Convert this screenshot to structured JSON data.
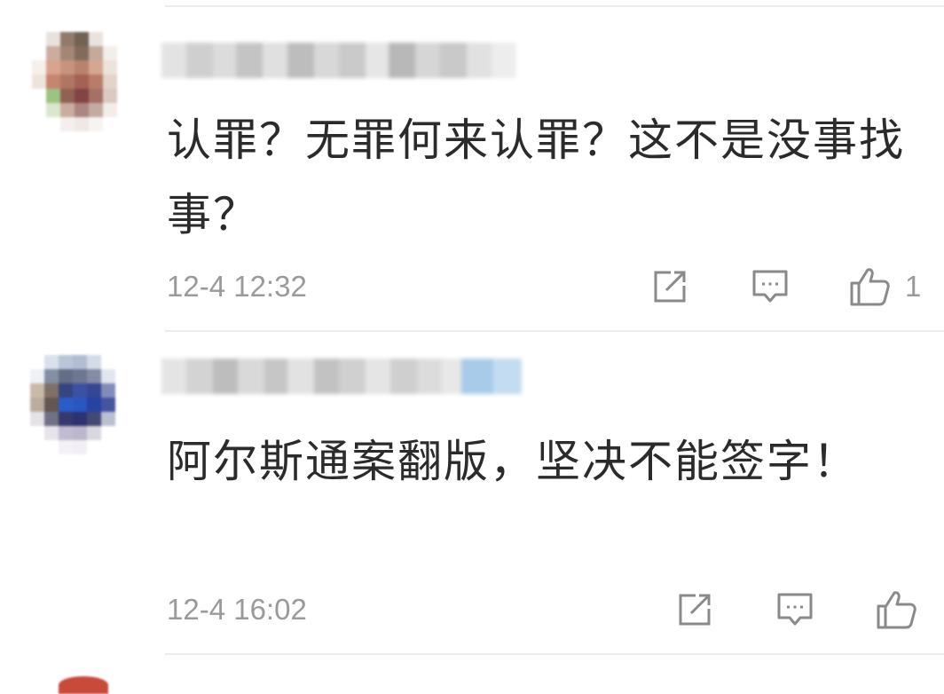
{
  "comments": [
    {
      "content": "认罪？无罪何来认罪？这不是没事找事？",
      "timestamp": "12-4 12:32",
      "like_count": "1",
      "icons": [
        "share-icon",
        "reply-icon",
        "thumbs-up-icon"
      ]
    },
    {
      "content": "阿尔斯通案翻版，坚决不能签字！",
      "timestamp": "12-4 16:02",
      "like_count": "",
      "icons": [
        "share-icon",
        "reply-icon",
        "thumbs-up-icon"
      ]
    }
  ],
  "colors": {
    "text": "#2b2b2b",
    "meta": "#9a9a9a",
    "icon": "#8a8a8a",
    "divider": "#ececec"
  }
}
